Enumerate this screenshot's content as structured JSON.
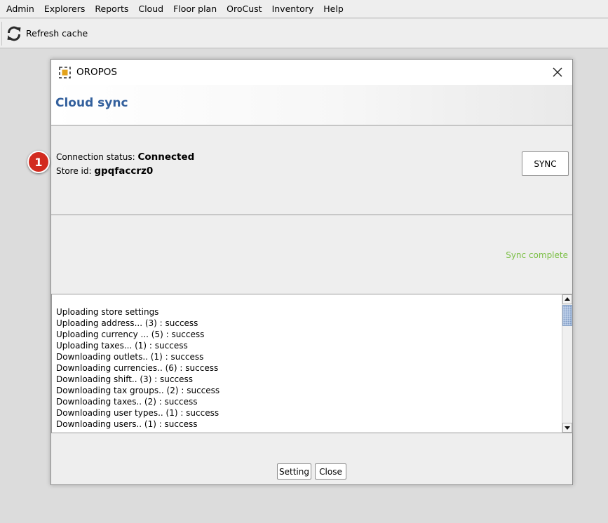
{
  "menubar": {
    "items": [
      "Admin",
      "Explorers",
      "Reports",
      "Cloud",
      "Floor plan",
      "OroCust",
      "Inventory",
      "Help"
    ]
  },
  "toolbar": {
    "refresh_icon": "refresh-icon",
    "refresh_label": "Refresh cache"
  },
  "dialog": {
    "title": "OROPOS",
    "heading": "Cloud sync",
    "status": {
      "connection_label": "Connection status:",
      "connection_value": "Connected",
      "store_label": "Store id:",
      "store_value": "gpqfaccrz0",
      "badge": "1"
    },
    "sync_button": "SYNC",
    "sync_message": "Sync complete",
    "sync_message_color": "#7bbf45",
    "log_lines": [
      "Uploading store settings",
      "Uploading address... (3) : success",
      "Uploading currency ... (5) : success",
      "Uploading taxes... (1) : success",
      "Downloading outlets.. (1) : success",
      "Downloading currencies.. (6) : success",
      "Downloading shift.. (3) : success",
      "Downloading tax groups.. (2) : success",
      "Downloading taxes.. (2) : success",
      "Downloading user types.. (1) : success",
      "Downloading users.. (1) : success"
    ],
    "buttons": {
      "setting": "Setting",
      "close": "Close"
    }
  },
  "colors": {
    "heading": "#33609d",
    "badge": "#d22b1f"
  }
}
